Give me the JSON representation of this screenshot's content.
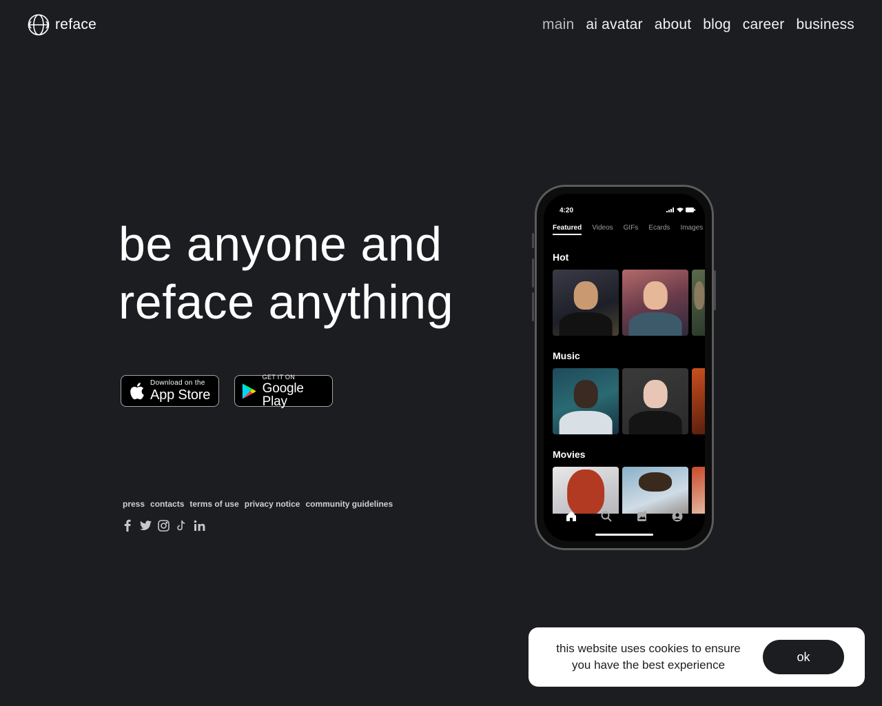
{
  "header": {
    "logo_text": "reface",
    "nav": [
      {
        "label": "main",
        "active": true
      },
      {
        "label": "ai avatar",
        "active": false
      },
      {
        "label": "about",
        "active": false
      },
      {
        "label": "blog",
        "active": false
      },
      {
        "label": "career",
        "active": false
      },
      {
        "label": "business",
        "active": false
      }
    ]
  },
  "hero": {
    "title_line1": "be anyone and",
    "title_line2": "reface anything"
  },
  "stores": {
    "app_store_small": "Download on the",
    "app_store_big": "App Store",
    "google_small": "GET IT ON",
    "google_big": "Google Play"
  },
  "footer": {
    "links": [
      "press",
      "contacts",
      "terms of use",
      "privacy notice",
      "community guidelines"
    ],
    "socials": [
      "facebook-icon",
      "twitter-icon",
      "instagram-icon",
      "tiktok-icon",
      "linkedin-icon"
    ]
  },
  "phone": {
    "time": "4:20",
    "tabs": [
      "Featured",
      "Videos",
      "GIFs",
      "Ecards",
      "Images"
    ],
    "sections": [
      "Hot",
      "Music",
      "Movies"
    ],
    "bottom_nav": [
      "home-icon",
      "search-icon",
      "add-image-icon",
      "profile-icon"
    ]
  },
  "cookie": {
    "line1": "this website uses cookies to ensure",
    "line2": "you have the best experience",
    "ok_label": "ok"
  },
  "colors": {
    "background": "#1c1d21",
    "text": "#ffffff",
    "cookie_bg": "#ffffff",
    "cookie_button": "#1c1d21"
  }
}
